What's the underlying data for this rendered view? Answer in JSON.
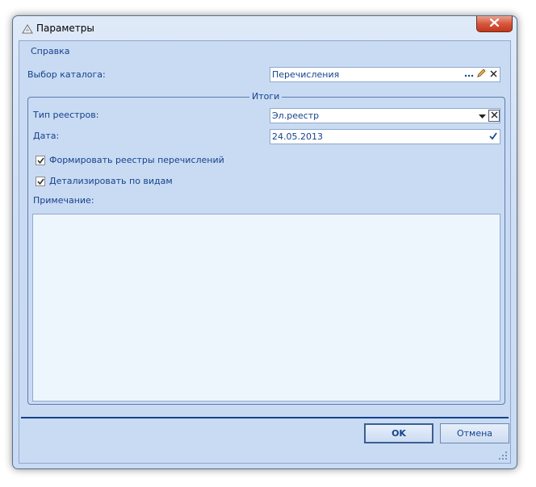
{
  "window": {
    "title": "Параметры",
    "close_glyph": "✕"
  },
  "menu": {
    "help_label": "Справка"
  },
  "catalog": {
    "label": "Выбор каталога:",
    "value": "Перечисления"
  },
  "totals": {
    "group_title": "Итоги",
    "registry_type": {
      "label": "Тип реестров:",
      "value": "Эл.реестр"
    },
    "date": {
      "label": "Дата:",
      "value": "24.05.2013"
    },
    "form_registries": {
      "label": "Формировать реестры перечислений",
      "checked": true
    },
    "detail_by_types": {
      "label": "Детализировать по видам",
      "checked": true
    },
    "note": {
      "label": "Примечание:",
      "value": ""
    }
  },
  "buttons": {
    "ok_label": "OK",
    "cancel_label": "Отмена"
  },
  "colors": {
    "text": "#15428b",
    "frame": "#c9dbf3",
    "close": "#d7573c"
  },
  "icons": [
    "window-app-icon",
    "close-icon",
    "ellipsis-icon",
    "edit-icon",
    "clear-icon",
    "dropdown-arrow-icon",
    "checkmark-icon",
    "resize-grip-icon"
  ]
}
